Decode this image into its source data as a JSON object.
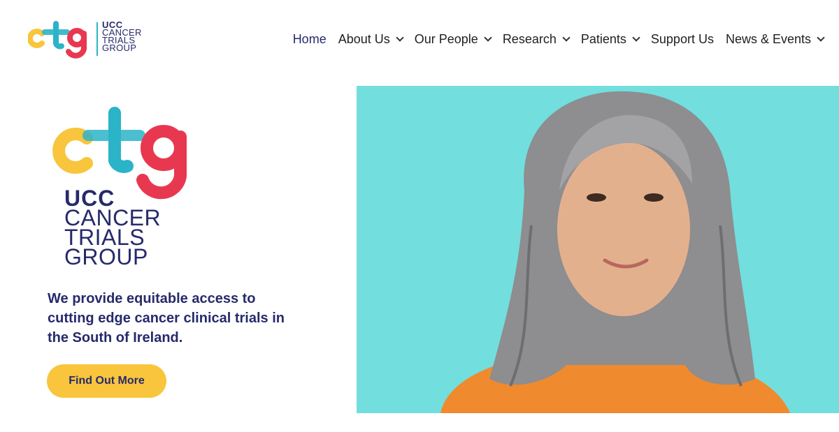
{
  "brand": {
    "mark": "ctg",
    "name_line1": "UCC",
    "name_line2": "CANCER",
    "name_line3": "TRIALS",
    "name_line4": "GROUP",
    "colors": {
      "yellow": "#f8c53c",
      "blue": "#2bb3c8",
      "red": "#e8384f",
      "navy": "#262a6b"
    }
  },
  "nav": {
    "items": [
      {
        "label": "Home",
        "dropdown": false,
        "active": true
      },
      {
        "label": "About Us",
        "dropdown": true
      },
      {
        "label": "Our People",
        "dropdown": true
      },
      {
        "label": "Research",
        "dropdown": true
      },
      {
        "label": "Patients",
        "dropdown": true
      },
      {
        "label": "Support Us",
        "dropdown": false
      },
      {
        "label": "News & Events",
        "dropdown": true
      }
    ]
  },
  "hero": {
    "tagline": "We provide equitable access to cutting edge cancer clinical trials in the South of Ireland.",
    "cta_label": "Find Out More",
    "image_bg": "#72dedd"
  }
}
